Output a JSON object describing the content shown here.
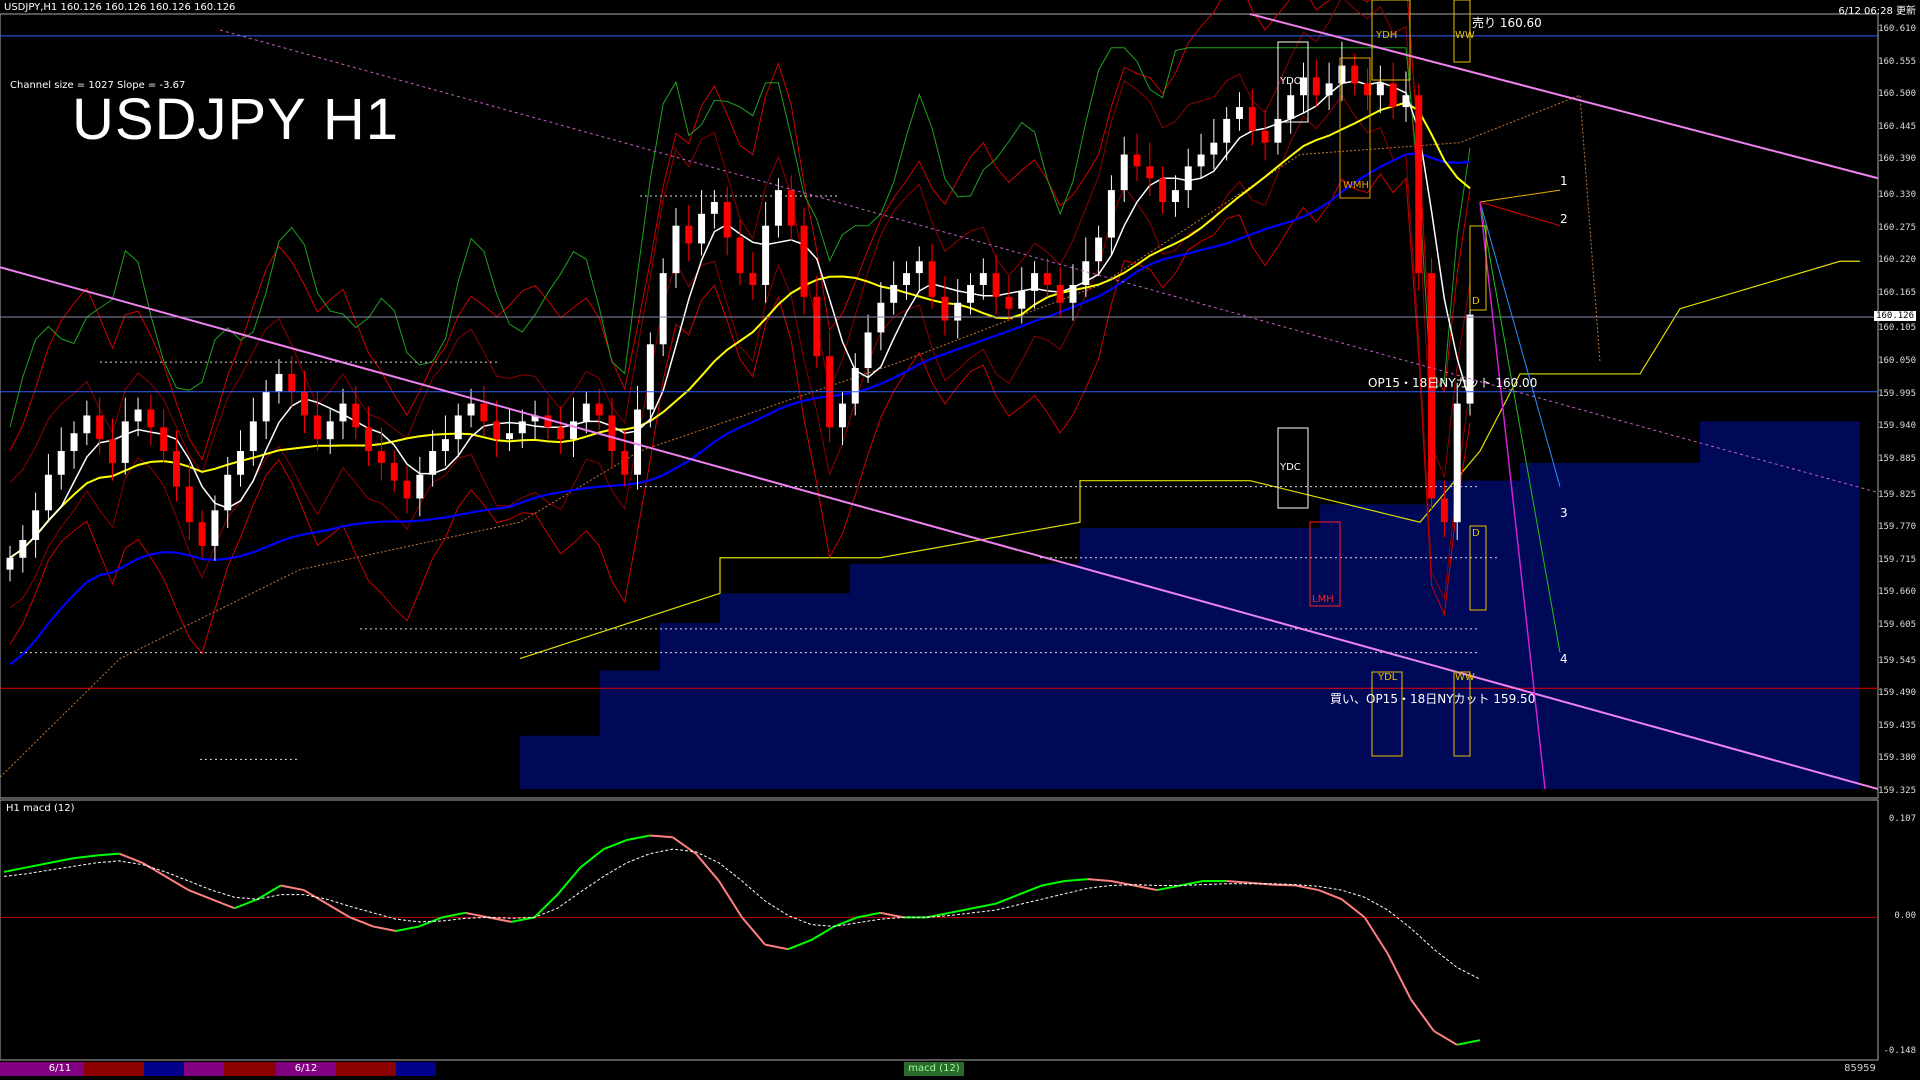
{
  "header": {
    "symbol_line": "USDJPY,H1  160.126 160.126 160.126 160.126",
    "datetime": "6/12 06:28 更新",
    "channel_info": "Channel size = 1027 Slope = -3.67",
    "macd_label": "H1  macd (12)"
  },
  "title": "USDJPY H1",
  "annotations": {
    "sell": "売り 160.60",
    "op_upper": "OP15・18日NYカット 160.00",
    "op_lower": "買い、OP15・18日NYカット 159.50",
    "ydh": "YDH",
    "ydo": "YDO",
    "ydc": "YDC",
    "ydl": "YDL",
    "lmh": "LMH",
    "wmh": "WMH",
    "d_upper": "D",
    "d_lower": "D",
    "ww_upper": "WW",
    "ww_lower": "WW",
    "proj_1": "1",
    "proj_2": "2",
    "proj_3": "3",
    "proj_4": "4"
  },
  "price_axis": [
    "160.610",
    "160.555",
    "160.500",
    "160.445",
    "160.390",
    "160.330",
    "160.275",
    "160.220",
    "160.165",
    "160.105",
    "160.050",
    "159.995",
    "159.940",
    "159.885",
    "159.825",
    "159.770",
    "159.715",
    "159.660",
    "159.605",
    "159.545",
    "159.490",
    "159.435",
    "159.380",
    "159.325"
  ],
  "current_price": "160.126",
  "macd_axis": [
    "0.107",
    "0.00",
    "-0.148"
  ],
  "footer": {
    "date1": "6/11",
    "date2": "6/12",
    "indicator": "macd (12)",
    "right_code": "85959"
  },
  "chart_data": {
    "type": "candlestick",
    "symbol": "USDJPY",
    "timeframe": "H1",
    "ylim": [
      159.325,
      160.61
    ],
    "macd_ylim": [
      -0.148,
      0.107
    ],
    "levels": {
      "sell_line": 160.6,
      "op_cut_upper": 160.0,
      "op_cut_lower": 159.5,
      "current": 160.126
    },
    "colors": {
      "bull": "#ffffff",
      "bear": "#ff0000",
      "ma_fast": "#ffffff",
      "ma_mid": "#ffff00",
      "ma_slow": "#0000ff",
      "channel": "#ee82ee",
      "macd_main_up": "#00ff00",
      "macd_main_down": "#ff8080"
    },
    "closes": [
      159.72,
      159.75,
      159.8,
      159.86,
      159.9,
      159.93,
      159.96,
      159.92,
      159.88,
      159.95,
      159.97,
      159.94,
      159.9,
      159.84,
      159.78,
      159.74,
      159.8,
      159.86,
      159.9,
      159.95,
      160.0,
      160.03,
      160.0,
      159.96,
      159.92,
      159.95,
      159.98,
      159.94,
      159.9,
      159.88,
      159.85,
      159.82,
      159.86,
      159.9,
      159.92,
      159.96,
      159.98,
      159.95,
      159.92,
      159.93,
      159.95,
      159.96,
      159.94,
      159.92,
      159.95,
      159.98,
      159.96,
      159.9,
      159.86,
      159.97,
      160.08,
      160.2,
      160.28,
      160.25,
      160.3,
      160.32,
      160.26,
      160.2,
      160.18,
      160.28,
      160.34,
      160.28,
      160.16,
      160.06,
      159.94,
      159.98,
      160.04,
      160.1,
      160.15,
      160.18,
      160.2,
      160.22,
      160.16,
      160.12,
      160.15,
      160.18,
      160.2,
      160.16,
      160.14,
      160.17,
      160.2,
      160.18,
      160.15,
      160.18,
      160.22,
      160.26,
      160.34,
      160.4,
      160.38,
      160.36,
      160.32,
      160.34,
      160.38,
      160.4,
      160.42,
      160.46,
      160.48,
      160.44,
      160.42,
      160.46,
      160.5,
      160.53,
      160.5,
      160.52,
      160.55,
      160.52,
      160.5,
      160.52,
      160.48,
      160.5,
      160.2,
      159.82,
      159.78,
      159.98,
      160.13
    ],
    "macd": [
      0.05,
      0.055,
      0.06,
      0.065,
      0.068,
      0.07,
      0.06,
      0.045,
      0.03,
      0.02,
      0.01,
      0.02,
      0.035,
      0.03,
      0.015,
      0.0,
      -0.01,
      -0.015,
      -0.01,
      0.0,
      0.005,
      0.0,
      -0.005,
      0.0,
      0.025,
      0.055,
      0.075,
      0.085,
      0.09,
      0.088,
      0.07,
      0.04,
      0.0,
      -0.03,
      -0.035,
      -0.025,
      -0.01,
      0.0,
      0.005,
      0.0,
      0.0,
      0.005,
      0.01,
      0.015,
      0.025,
      0.035,
      0.04,
      0.042,
      0.04,
      0.035,
      0.03,
      0.035,
      0.04,
      0.04,
      0.038,
      0.036,
      0.035,
      0.03,
      0.02,
      0.0,
      -0.04,
      -0.09,
      -0.125,
      -0.14,
      -0.135
    ],
    "macd_signal": [
      0.045,
      0.048,
      0.052,
      0.056,
      0.06,
      0.062,
      0.058,
      0.05,
      0.04,
      0.03,
      0.022,
      0.02,
      0.025,
      0.025,
      0.02,
      0.012,
      0.005,
      -0.002,
      -0.005,
      -0.004,
      -0.001,
      0.0,
      -0.001,
      0.0,
      0.01,
      0.028,
      0.045,
      0.06,
      0.07,
      0.075,
      0.072,
      0.06,
      0.04,
      0.018,
      0.002,
      -0.008,
      -0.01,
      -0.006,
      -0.002,
      0.0,
      0.0,
      0.002,
      0.005,
      0.008,
      0.014,
      0.02,
      0.026,
      0.032,
      0.035,
      0.036,
      0.035,
      0.035,
      0.036,
      0.037,
      0.037,
      0.037,
      0.036,
      0.034,
      0.03,
      0.022,
      0.008,
      -0.012,
      -0.035,
      -0.055,
      -0.068
    ]
  }
}
